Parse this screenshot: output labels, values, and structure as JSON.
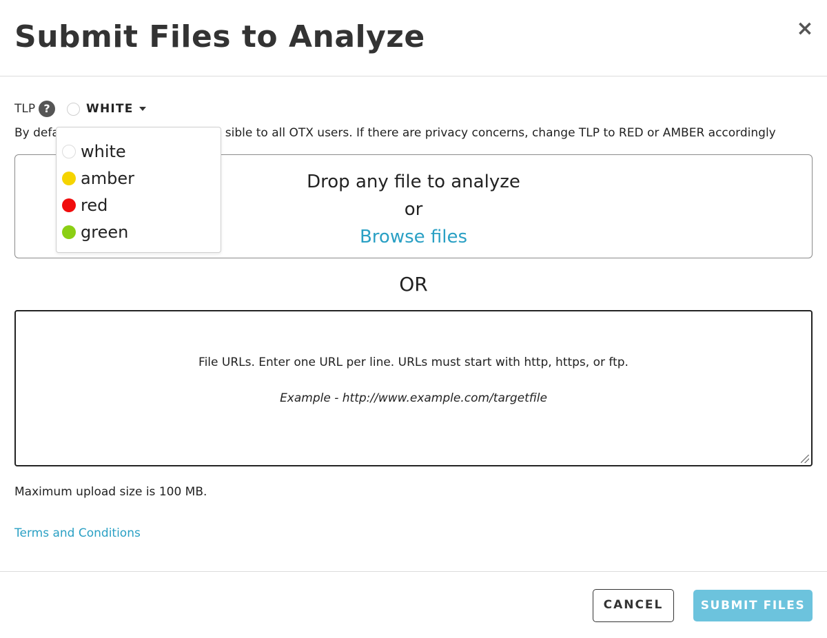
{
  "modal": {
    "title": "Submit Files to Analyze",
    "close_glyph": "×"
  },
  "tlp": {
    "label": "TLP",
    "help_glyph": "?",
    "selected": "WHITE",
    "info_text": "By default files are visible to all OTX users. If there are privacy concerns, change TLP to RED or AMBER accordingly",
    "info_visible_prefix": "By defa",
    "info_visible_suffix": "sible to all OTX users. If there are privacy concerns, change TLP to RED or AMBER accordingly",
    "options": [
      {
        "label": "white",
        "color": "#ffffff"
      },
      {
        "label": "amber",
        "color": "#f5d400"
      },
      {
        "label": "red",
        "color": "#f00c0c"
      },
      {
        "label": "green",
        "color": "#8bcf14"
      }
    ]
  },
  "dropzone": {
    "line1": "Drop any file to analyze",
    "line2": "or",
    "browse_label": "Browse files"
  },
  "or_text": "OR",
  "urls": {
    "placeholder_line1": "File URLs. Enter one URL per line. URLs must start with http, https, or ftp.",
    "placeholder_line2": "Example - http://www.example.com/targetfile",
    "value": ""
  },
  "max_size_text": "Maximum upload size is 100 MB.",
  "terms_label": "Terms and Conditions",
  "buttons": {
    "cancel": "CANCEL",
    "submit": "SUBMIT FILES"
  },
  "colors": {
    "link": "#2aa0c4",
    "submit_bg": "#6cc3dd"
  }
}
